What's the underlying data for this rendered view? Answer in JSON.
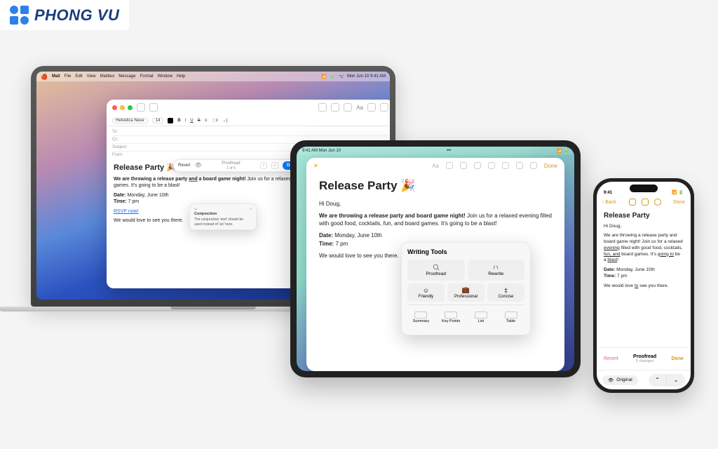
{
  "brand": {
    "name": "PHONG VU"
  },
  "macos": {
    "menubar": {
      "app": "Mail",
      "items": [
        "File",
        "Edit",
        "View",
        "Mailbox",
        "Message",
        "Format",
        "Window",
        "Help"
      ],
      "clock": "Mon Jun 10  9:41 AM"
    },
    "mail": {
      "font_family": "Helvetica Neue",
      "font_size": "14",
      "headers": {
        "to": "To:",
        "cc": "Cc:",
        "subject": "Subject:",
        "from": "From:"
      },
      "title": "Release Party 🎉",
      "intro_bold": "We are throwing a release party",
      "intro_conj": "and",
      "intro_bold2": "a board game night!",
      "intro_rest": "Join us for a relaxed evening filled with good food and board games. It's going to be a blast!",
      "date_label": "Date:",
      "date_value": "Monday, June 10th",
      "time_label": "Time:",
      "time_value": "7 pm",
      "rsvp": "RSVP now!",
      "closing": "We would love to see you there.",
      "proofread": {
        "revert": "Revert",
        "progress": "Proofread",
        "count": "1 of 5",
        "done": "Done"
      },
      "tooltip": {
        "tag": "AI",
        "undo": "↺",
        "title": "Conjunction",
        "body": "The conjunction 'and' should be used instead of 'an' here."
      }
    }
  },
  "ipad": {
    "status_left": "9:41 AM   Mon Jun 10",
    "toolbar": {
      "aa": "Aa",
      "done": "Done",
      "more": "•••"
    },
    "doc": {
      "title": "Release Party 🎉",
      "greeting": "Hi Doug,",
      "intro_bold": "We are throwing a release party and board game night!",
      "intro_rest": "Join us for a relaxed evening filled with good food, cocktails, fun, and board games. It's going to be a blast!",
      "date_label": "Date:",
      "date_value": "Monday, June 10th",
      "time_label": "Time:",
      "time_value": "7 pm",
      "closing": "We would love to see you there."
    },
    "writing_tools": {
      "title": "Writing Tools",
      "proofread": "Proofread",
      "rewrite": "Rewrite",
      "friendly": "Friendly",
      "professional": "Professional",
      "concise": "Concise",
      "summary": "Summary",
      "keypoints": "Key Points",
      "list": "List",
      "table": "Table"
    }
  },
  "iphone": {
    "time": "9:41",
    "nav": {
      "back": "Back",
      "done": "Done"
    },
    "doc": {
      "title": "Release Party",
      "greeting": "Hi Doug,",
      "line1a": "We are throwing a release party and board game night! Join us for a relaxed ",
      "und1": "evening",
      "line1b": " filled with good food, cocktails, ",
      "und2": "fun, and",
      "line1c": " board games. It's ",
      "und3": "going to",
      "line1d": " be a ",
      "und4": "blast",
      "line1e": "!",
      "date_label": "Date:",
      "date_value": "Monday, June 10th",
      "time_label": "Time:",
      "time_value": "7 pm",
      "closing_a": "We would love ",
      "closing_und": "to",
      "closing_b": " see you there."
    },
    "bar": {
      "revert": "Revert",
      "title": "Proofread",
      "sub": "5 changes",
      "done": "Done",
      "original": "Original"
    }
  }
}
